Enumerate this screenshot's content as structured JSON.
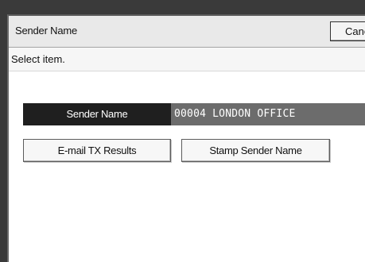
{
  "header": {
    "title": "Sender Name",
    "cancel_label": "Cancel"
  },
  "message": {
    "text": "Select item."
  },
  "sender_field": {
    "label": "Sender Name",
    "value": "00004 LONDON OFFICE"
  },
  "options": {
    "email_tx_results": "E-mail TX Results",
    "stamp_sender_name": "Stamp Sender Name"
  },
  "colors": {
    "frame": "#3a3a3a",
    "title_bar": "#e9e9e9",
    "field_label_bg": "#1f1f1f",
    "field_value_bg": "#6c6c6c",
    "button_bg": "#f7f7f7"
  }
}
